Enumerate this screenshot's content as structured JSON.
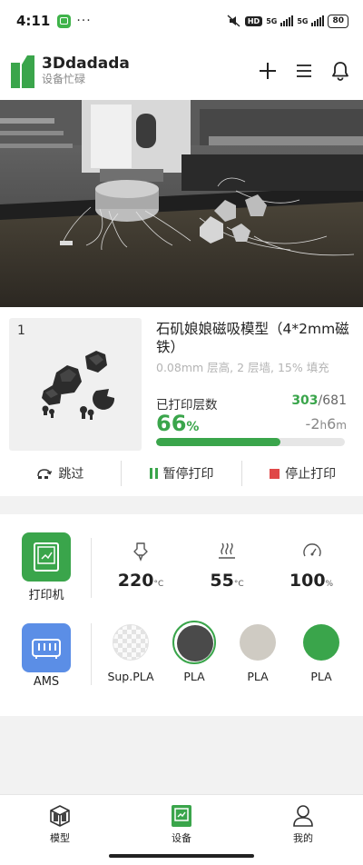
{
  "status_bar": {
    "time": "4:11",
    "overflow": "···",
    "network_badge": "HD",
    "network_1": "5G",
    "network_2": "5G",
    "battery": "80"
  },
  "header": {
    "brand_name": "3Ddadada",
    "brand_sub": "设备忙碌",
    "actions": [
      "plus-icon",
      "menu-icon",
      "bell-icon"
    ]
  },
  "print_job": {
    "plate_number": "1",
    "title": "石矶娘娘磁吸模型（4*2mm磁铁）",
    "meta": "0.08mm 层高, 2 层墙, 15% 填充",
    "layers_label": "已打印层数",
    "layers_current": "303",
    "layers_total": "/681",
    "percent": "66",
    "percent_unit": "%",
    "remaining_prefix": "-2",
    "remaining_h": "h",
    "remaining_m": "6",
    "remaining_m_unit": "m",
    "progress": 0.66,
    "controls": {
      "skip": "跳过",
      "pause": "暂停打印",
      "stop": "停止打印"
    }
  },
  "device": {
    "printer_label": "打印机",
    "nozzle_temp": "220",
    "bed_temp": "55",
    "temp_unit": "°C",
    "fan_speed": "100",
    "fan_unit": "%",
    "ams_label": "AMS",
    "filaments": [
      {
        "label": "Sup.PLA",
        "color": "transparent",
        "active": false
      },
      {
        "label": "PLA",
        "color": "#4a4a4a",
        "active": true
      },
      {
        "label": "PLA",
        "color": "#cfcbc3",
        "active": false
      },
      {
        "label": "PLA",
        "color": "#3aa54b",
        "active": false
      }
    ]
  },
  "bottom_nav": {
    "models": "模型",
    "devices": "设备",
    "mine": "我的"
  },
  "colors": {
    "accent": "#3aa54b",
    "stop": "#e04848",
    "ams_blue": "#5b8ee6"
  }
}
